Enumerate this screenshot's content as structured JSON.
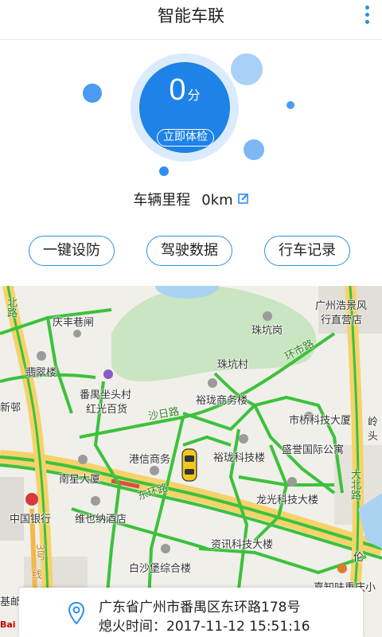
{
  "header": {
    "title": "智能车联",
    "menu_icon": "more-vertical-icon"
  },
  "dashboard": {
    "score_value": "0",
    "score_unit": "分",
    "check_button": "立即体检",
    "mileage_label": "车辆里程",
    "mileage_value": "0km",
    "edit_icon": "edit-icon",
    "accent_color": "#1e82e8"
  },
  "actions": [
    {
      "label": "一键设防"
    },
    {
      "label": "驾驶数据"
    },
    {
      "label": "行车记录"
    }
  ],
  "map": {
    "pois": {
      "qingfeng": "庆丰巷闸",
      "feicui": "翡翠楼",
      "xinyou": "新邨",
      "panyu": "番禺坐头村",
      "hongguang": "红光百货",
      "gangxin": "港信商务",
      "nanxing": "南星大厦",
      "boc": "中国银行",
      "weiyena": "维也纳酒店",
      "zhukeng_gang": "珠坑岗",
      "zhukeng_cun": "珠坑村",
      "yulong_sw": "裕珑商务楼",
      "yulong_kj": "裕珑科技楼",
      "shiqiao": "市桥科技大厦",
      "shengyu": "盛誉国际公寓",
      "longguang": "龙光科技大楼",
      "zixun": "资讯科技大楼",
      "baishabao": "白沙堡综合楼",
      "haojing_1": "广州浩景风",
      "haojing_2": "行直营店",
      "jiu": "基邮",
      "jiu_right": "岭",
      "jiu_right2": "头",
      "zhanfu": "嘉知味重庆小",
      "lunhui": "伦"
    },
    "roads": {
      "shari": "沙日路",
      "donghuan": "东环路",
      "huanshi": "环市路",
      "dongguang": "大北路",
      "line3_a": "3号",
      "line3_b": "线",
      "north": "北路"
    },
    "watermark": "Bai"
  },
  "location": {
    "address": "广东省广州市番禺区东环路178号",
    "time_label": "熄火时间：",
    "time_value": "2017-11-12 15:51:16",
    "pin_icon": "location-pin-icon"
  }
}
